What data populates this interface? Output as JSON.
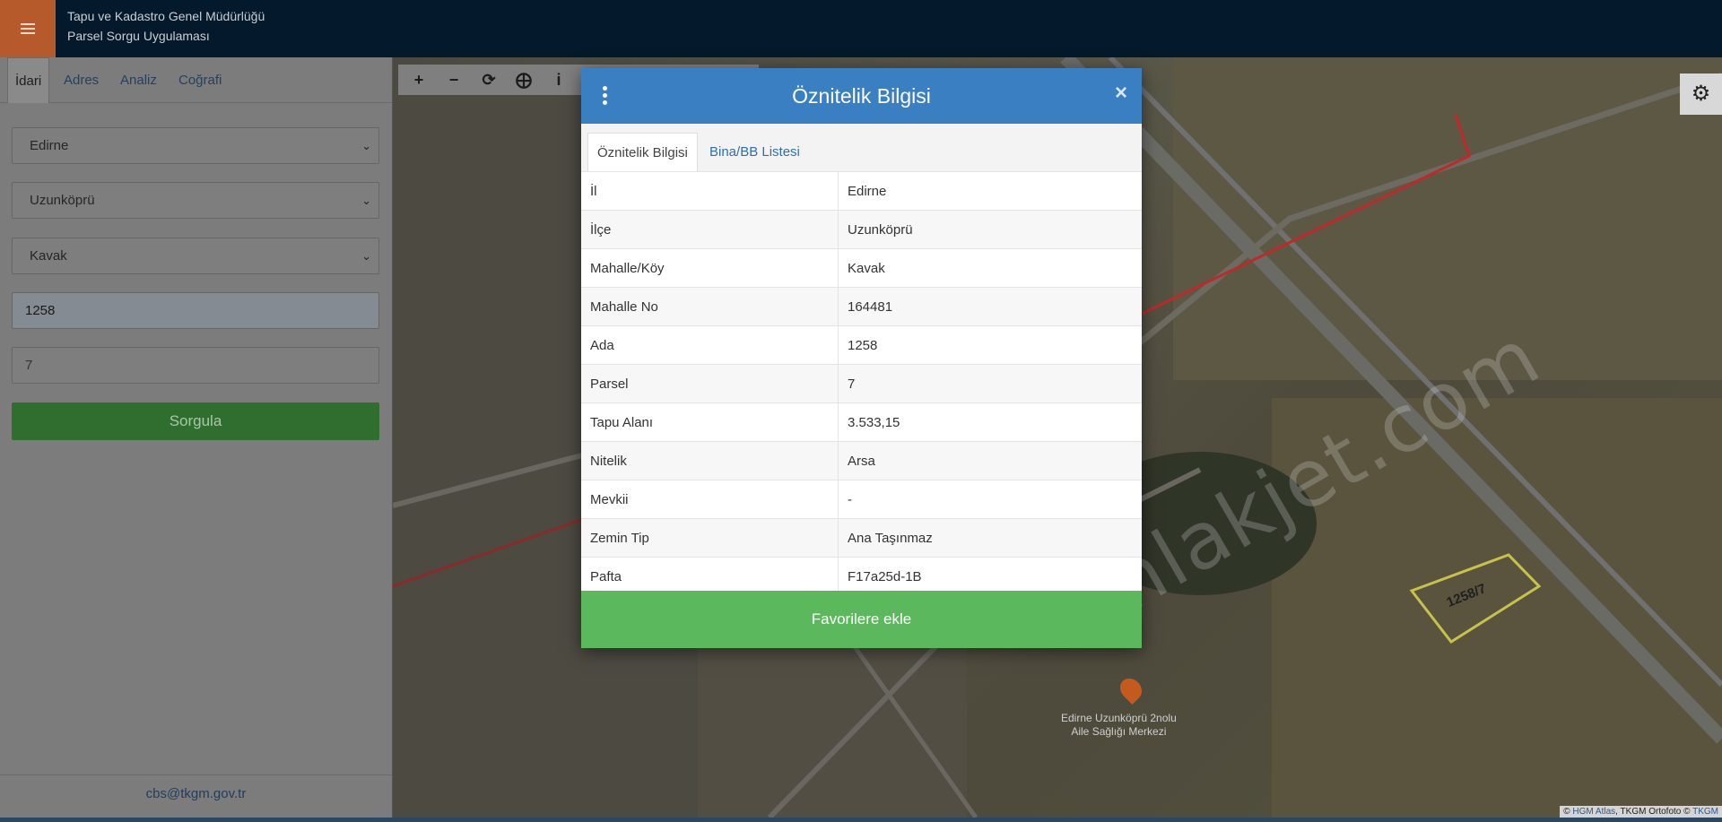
{
  "header": {
    "menu_icon": "hamburger-icon",
    "title_line1": "Tapu ve Kadastro Genel Müdürlüğü",
    "title_line2": "Parsel Sorgu Uygulaması"
  },
  "sidebar": {
    "tabs": [
      {
        "label": "İdari",
        "active": true
      },
      {
        "label": "Adres",
        "active": false
      },
      {
        "label": "Analiz",
        "active": false
      },
      {
        "label": "Coğrafi",
        "active": false
      }
    ],
    "il_select": "Edirne",
    "ilce_select": "Uzunköprü",
    "mahalle_select": "Kavak",
    "ada_input": "1258",
    "parsel_input": "7",
    "query_button": "Sorgula",
    "footer_email": "cbs@tkgm.gov.tr"
  },
  "map": {
    "toolbar_icons": [
      "zoom-in-icon",
      "zoom-out-icon",
      "refresh-icon",
      "locate-icon",
      "info-icon"
    ],
    "settings_icon": "gear-icon",
    "parcel_label": "1258/7",
    "poi_label_line1": "Edirne Uzunköprü 2nolu",
    "poi_label_line2": "Aile Sağlığı Merkezi",
    "attribution_prefix": "©",
    "attribution_link1": "HGM Atlas",
    "attribution_mid": ", TKGM Ortofoto ©",
    "attribution_link2": "TKGM",
    "watermark": "emlakjet.com",
    "colors": {
      "parcel_outline": "#c9c24a",
      "boundary_line": "#c0282a"
    }
  },
  "modal": {
    "title": "Öznitelik Bilgisi",
    "close_icon": "close-icon",
    "menu_icon": "kebab-menu-icon",
    "tabs": [
      {
        "label": "Öznitelik Bilgisi",
        "active": true
      },
      {
        "label": "Bina/BB Listesi",
        "active": false
      }
    ],
    "rows": [
      {
        "key": "İl",
        "value": "Edirne"
      },
      {
        "key": "İlçe",
        "value": "Uzunköprü"
      },
      {
        "key": "Mahalle/Köy",
        "value": "Kavak"
      },
      {
        "key": "Mahalle No",
        "value": "164481"
      },
      {
        "key": "Ada",
        "value": "1258"
      },
      {
        "key": "Parsel",
        "value": "7"
      },
      {
        "key": "Tapu Alanı",
        "value": "3.533,15"
      },
      {
        "key": "Nitelik",
        "value": "Arsa"
      },
      {
        "key": "Mevkii",
        "value": "-"
      },
      {
        "key": "Zemin Tip",
        "value": "Ana Taşınmaz"
      },
      {
        "key": "Pafta",
        "value": "F17a25d-1B"
      }
    ],
    "favorite_button": "Favorilere ekle",
    "colors": {
      "header": "#3a7fc1",
      "favorite": "#5cb85c"
    }
  }
}
